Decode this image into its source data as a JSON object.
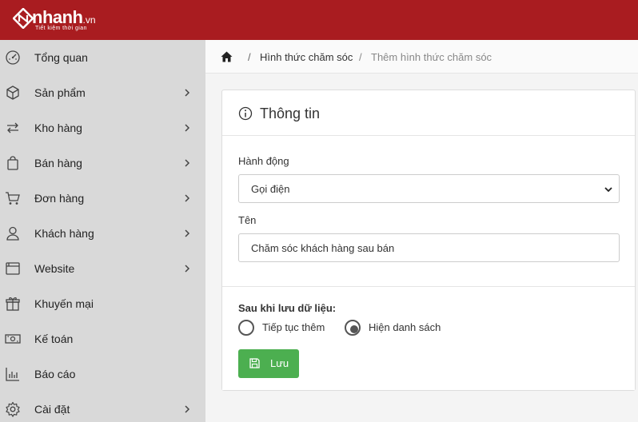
{
  "brand": {
    "name": "nhanh",
    "suffix": ".vn",
    "tagline": "Tiết kiệm thời gian"
  },
  "sidebar": {
    "items": [
      {
        "label": "Tổng quan",
        "icon": "dashboard-gauge-icon",
        "has_submenu": false
      },
      {
        "label": "Sản phẩm",
        "icon": "box-icon",
        "has_submenu": true
      },
      {
        "label": "Kho hàng",
        "icon": "transfer-arrows-icon",
        "has_submenu": true
      },
      {
        "label": "Bán hàng",
        "icon": "shopping-bag-icon",
        "has_submenu": true
      },
      {
        "label": "Đơn hàng",
        "icon": "cart-icon",
        "has_submenu": true
      },
      {
        "label": "Khách hàng",
        "icon": "user-icon",
        "has_submenu": true
      },
      {
        "label": "Website",
        "icon": "browser-window-icon",
        "has_submenu": true
      },
      {
        "label": "Khuyến mại",
        "icon": "gift-icon",
        "has_submenu": false
      },
      {
        "label": "Kế toán",
        "icon": "money-icon",
        "has_submenu": false
      },
      {
        "label": "Báo cáo",
        "icon": "bar-chart-icon",
        "has_submenu": false
      },
      {
        "label": "Cài đặt",
        "icon": "gear-icon",
        "has_submenu": true
      }
    ]
  },
  "breadcrumb": {
    "home_icon": "home-icon",
    "separator": "/",
    "parent": "Hình thức chăm sóc",
    "current": "Thêm hình thức chăm sóc"
  },
  "card": {
    "title": "Thông tin",
    "title_icon": "info-circle-icon",
    "action": {
      "label": "Hành động",
      "selected": "Gọi điện"
    },
    "name": {
      "label": "Tên",
      "value": "Chăm sóc khách hàng sau bán"
    },
    "after_save": {
      "label": "Sau khi lưu dữ liệu:",
      "options": [
        {
          "label": "Tiếp tục thêm",
          "checked": false
        },
        {
          "label": "Hiện danh sách",
          "checked": true
        }
      ]
    },
    "save_button": {
      "label": "Lưu",
      "icon": "floppy-disk-icon"
    }
  },
  "colors": {
    "topbar": "#a91c20",
    "sidebar": "#d9d9d9",
    "save_button": "#4caf50"
  }
}
